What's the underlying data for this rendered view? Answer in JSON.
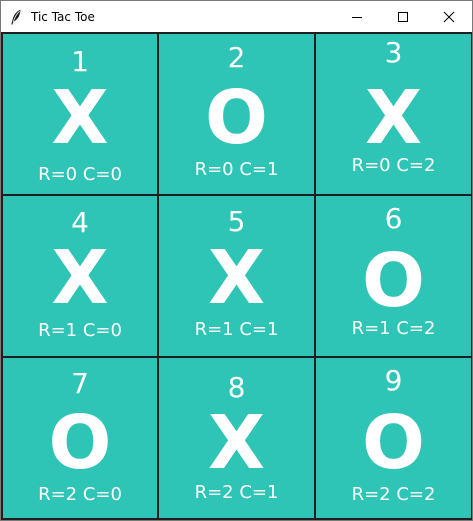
{
  "window": {
    "title": "Tic Tac Toe",
    "app_icon": "feather-icon",
    "controls": {
      "minimize_icon": "minimize-icon",
      "maximize_icon": "maximize-icon",
      "close_icon": "close-icon"
    }
  },
  "colors": {
    "cell_background": "#2ec4b6",
    "cell_text": "#ffffff",
    "grid_line": "#1f1f1f"
  },
  "board": {
    "cells": [
      {
        "number": "1",
        "mark": "X",
        "coord": "R=0 C=0"
      },
      {
        "number": "2",
        "mark": "O",
        "coord": "R=0 C=1"
      },
      {
        "number": "3",
        "mark": "X",
        "coord": "R=0 C=2"
      },
      {
        "number": "4",
        "mark": "X",
        "coord": "R=1 C=0"
      },
      {
        "number": "5",
        "mark": "X",
        "coord": "R=1 C=1"
      },
      {
        "number": "6",
        "mark": "O",
        "coord": "R=1 C=2"
      },
      {
        "number": "7",
        "mark": "O",
        "coord": "R=2 C=0"
      },
      {
        "number": "8",
        "mark": "X",
        "coord": "R=2 C=1"
      },
      {
        "number": "9",
        "mark": "O",
        "coord": "R=2 C=2"
      }
    ]
  }
}
